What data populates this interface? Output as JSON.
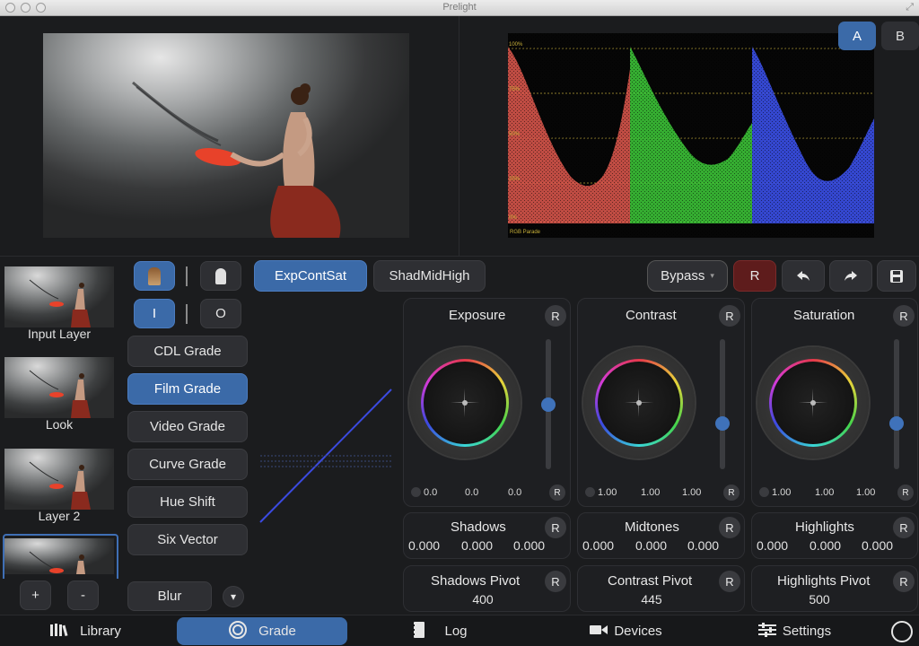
{
  "window": {
    "title": "Prelight"
  },
  "ab": {
    "a": "A",
    "b": "B"
  },
  "layers": [
    {
      "label": "Input Layer"
    },
    {
      "label": "Look"
    },
    {
      "label": "Layer 2"
    },
    {
      "label": ""
    }
  ],
  "layer_controls": {
    "add": "+",
    "remove": "-"
  },
  "toggles": {
    "in": "I",
    "out": "O"
  },
  "grade_types": [
    "CDL Grade",
    "Film Grade",
    "Video Grade",
    "Curve Grade",
    "Hue Shift",
    "Six Vector"
  ],
  "selected_grade": "Film Grade",
  "blur": {
    "label": "Blur",
    "dropdown": "▾"
  },
  "tabs": {
    "tab1": "ExpContSat",
    "tab2": "ShadMidHigh"
  },
  "toolbar": {
    "bypass": "Bypass",
    "bypass_arrow": "▾",
    "reset": "R"
  },
  "wheels": [
    {
      "title": "Exposure",
      "reset": "R",
      "values": [
        "0.0",
        "0.0",
        "0.0"
      ],
      "slider_level": 0.5
    },
    {
      "title": "Contrast",
      "reset": "R",
      "values": [
        "1.00",
        "1.00",
        "1.00"
      ],
      "slider_level": 0.33
    },
    {
      "title": "Saturation",
      "reset": "R",
      "values": [
        "1.00",
        "1.00",
        "1.00"
      ],
      "slider_level": 0.33
    }
  ],
  "tones": [
    {
      "title": "Shadows",
      "reset": "R",
      "values": [
        "0.000",
        "0.000",
        "0.000"
      ]
    },
    {
      "title": "Midtones",
      "reset": "R",
      "values": [
        "0.000",
        "0.000",
        "0.000"
      ]
    },
    {
      "title": "Highlights",
      "reset": "R",
      "values": [
        "0.000",
        "0.000",
        "0.000"
      ]
    }
  ],
  "pivots": [
    {
      "title": "Shadows Pivot",
      "reset": "R",
      "value": "400"
    },
    {
      "title": "Contrast Pivot",
      "reset": "R",
      "value": "445"
    },
    {
      "title": "Highlights Pivot",
      "reset": "R",
      "value": "500"
    }
  ],
  "scope": {
    "caption": "RGB Parade",
    "ticks": [
      "100%",
      "75%",
      "50%",
      "25%",
      "0%"
    ]
  },
  "nav": [
    {
      "label": "Library",
      "icon": "library-icon"
    },
    {
      "label": "Grade",
      "icon": "grade-icon"
    },
    {
      "label": "Log",
      "icon": "log-icon"
    },
    {
      "label": "Devices",
      "icon": "devices-icon"
    },
    {
      "label": "Settings",
      "icon": "settings-icon"
    }
  ],
  "active_nav": "Grade",
  "colors": {
    "accent": "#3b6aa8",
    "reset_red": "#6e1f1f",
    "scope_red": "#e0594f",
    "scope_green": "#3ecb3a",
    "scope_blue": "#3a4fe6"
  }
}
